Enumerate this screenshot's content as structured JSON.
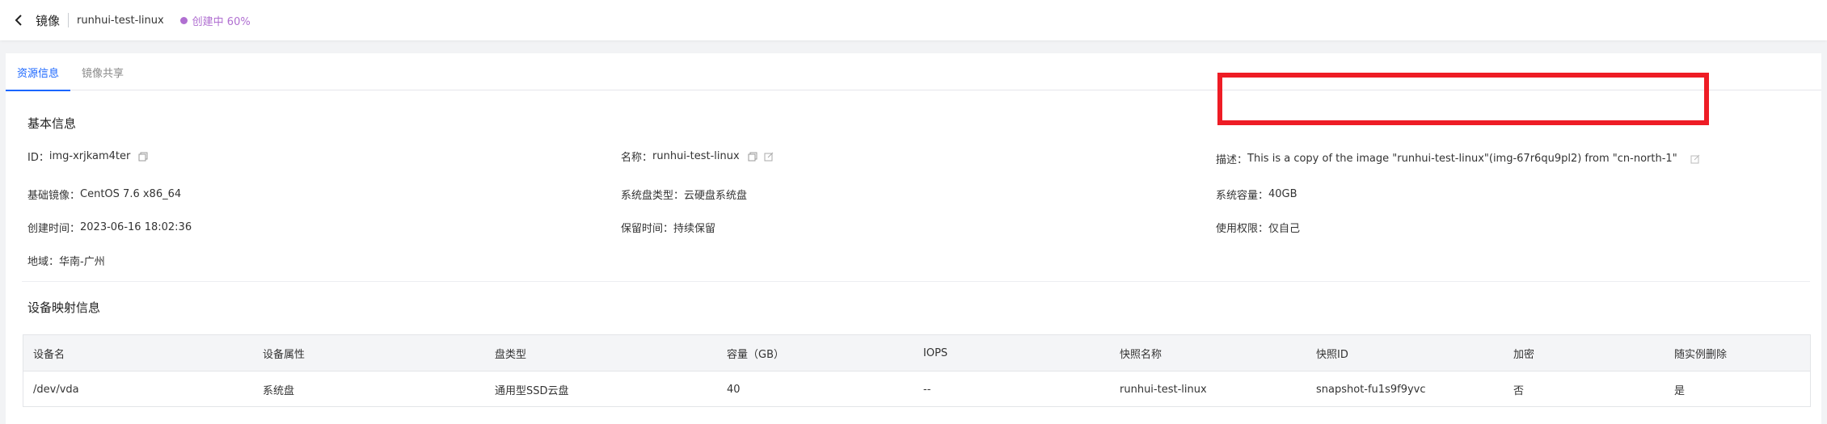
{
  "header": {
    "title": "镜像",
    "image_name": "runhui-test-linux",
    "status_text": "创建中 60%",
    "status_progress": 60,
    "status_color": "#b06fd1"
  },
  "tabs": [
    {
      "label": "资源信息",
      "active": true
    },
    {
      "label": "镜像共享",
      "active": false
    }
  ],
  "basic_info": {
    "title": "基本信息",
    "id": {
      "label": "ID：",
      "value": "img-xrjkam4ter"
    },
    "name": {
      "label": "名称：",
      "value": "runhui-test-linux"
    },
    "description": {
      "label": "描述：",
      "value": "This is a copy of the image \"runhui-test-linux\"(img-67r6qu9pl2) from \"cn-north-1\""
    },
    "base_image": {
      "label": "基础镜像：",
      "value": "CentOS 7.6 x86_64"
    },
    "system_disk_type": {
      "label": "系统盘类型：",
      "value": "云硬盘系统盘"
    },
    "system_capacity": {
      "label": "系统容量：",
      "value": "40GB"
    },
    "created_time": {
      "label": "创建时间：",
      "value": "2023-06-16 18:02:36"
    },
    "retention": {
      "label": "保留时间：",
      "value": "持续保留"
    },
    "permission": {
      "label": "使用权限：",
      "value": "仅自己"
    },
    "region": {
      "label": "地域：",
      "value": "华南-广州"
    }
  },
  "device_mapping": {
    "title": "设备映射信息",
    "columns": [
      "设备名",
      "设备属性",
      "盘类型",
      "容量（GB）",
      "IOPS",
      "快照名称",
      "快照ID",
      "加密",
      "随实例删除"
    ],
    "rows": [
      [
        "/dev/vda",
        "系统盘",
        "通用型SSD云盘",
        "40",
        "--",
        "runhui-test-linux",
        "snapshot-fu1s9f9yvc",
        "否",
        "是"
      ]
    ]
  },
  "colors": {
    "accent": "#1a66ff",
    "highlight_border": "#ee1c25"
  }
}
